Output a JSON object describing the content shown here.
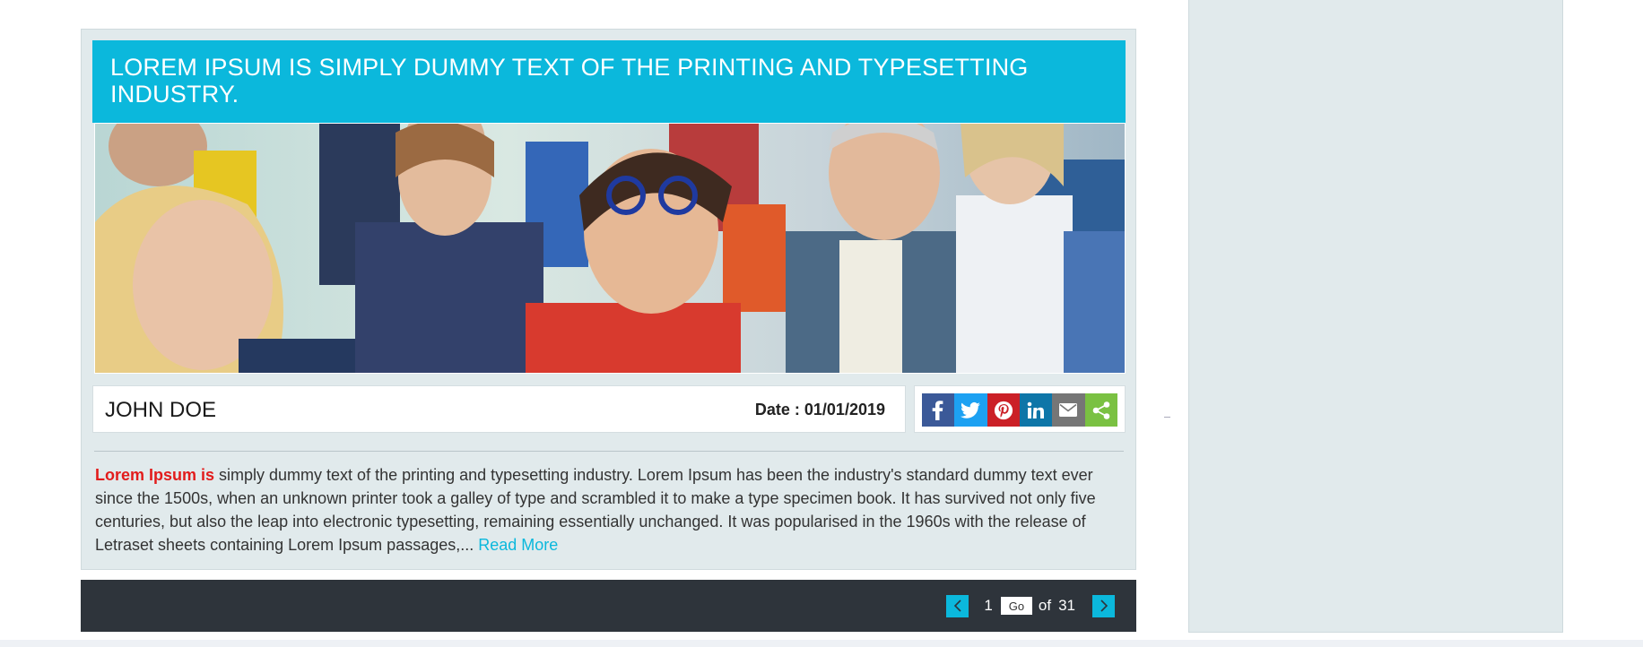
{
  "article": {
    "title": "LOREM IPSUM IS SIMPLY DUMMY TEXT OF THE PRINTING AND TYPESETTING INDUSTRY.",
    "image_alt": "Group of smiling people applauding",
    "author": "JOHN DOE",
    "date": "Date : 01/01/2019",
    "excerpt_lead": "Lorem Ipsum is",
    "excerpt_body": " simply dummy text of the printing and typesetting industry. Lorem Ipsum has been the industry's standard dummy text ever since the 1500s, when an unknown printer took a galley of type and scrambled it to make a type specimen book. It has survived not only five centuries, but also the leap into electronic typesetting, remaining essentially unchanged. It was popularised in the 1960s with the release of Letraset sheets containing Lorem Ipsum passages,... ",
    "read_more": "Read More"
  },
  "share": {
    "buttons": [
      {
        "name": "facebook",
        "icon": "facebook-icon",
        "color": "#3b5998"
      },
      {
        "name": "twitter",
        "icon": "twitter-icon",
        "color": "#1da1f2"
      },
      {
        "name": "pinterest",
        "icon": "pinterest-icon",
        "color": "#cb2027"
      },
      {
        "name": "linkedin",
        "icon": "linkedin-icon",
        "color": "#0e76a8"
      },
      {
        "name": "email",
        "icon": "mail-icon",
        "color": "#767676"
      },
      {
        "name": "share",
        "icon": "share-icon",
        "color": "#7ac142"
      }
    ]
  },
  "pagination": {
    "current": "1",
    "go_label": "Go",
    "of_label": "of",
    "total": "31"
  },
  "colors": {
    "accent": "#0bb8dc",
    "lead_text": "#e21c1c",
    "pager_bg": "#2e343b",
    "card_bg": "#e1eaec"
  }
}
